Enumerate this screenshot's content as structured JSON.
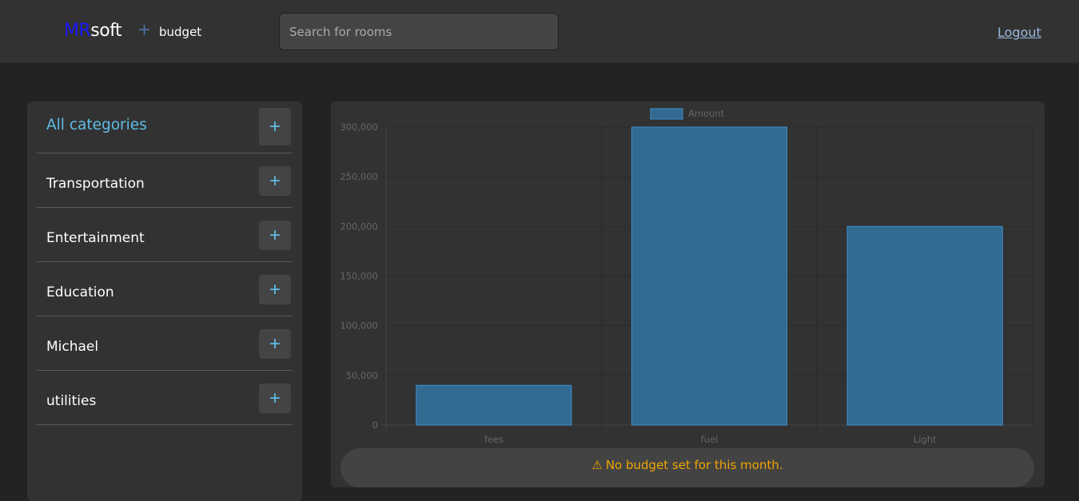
{
  "header": {
    "logo_part1": "MR",
    "logo_part2": "soft",
    "plus_symbol": "+",
    "app_name": "budget",
    "search_placeholder": "Search for rooms",
    "logout_label": "Logout"
  },
  "sidebar": {
    "items": [
      {
        "label": "All categories",
        "active": true
      },
      {
        "label": "Transportation"
      },
      {
        "label": "Entertainment"
      },
      {
        "label": "Education"
      },
      {
        "label": "Michael"
      },
      {
        "label": "utilities"
      }
    ],
    "add_symbol": "+"
  },
  "chart_data": {
    "type": "bar",
    "categories": [
      "fees",
      "fuel",
      "Light"
    ],
    "series": [
      {
        "name": "Amount",
        "values": [
          40000,
          300000,
          200000
        ]
      }
    ],
    "ylim": [
      0,
      300000
    ],
    "yticks": [
      "0",
      "50,000",
      "100,000",
      "150,000",
      "200,000",
      "250,000",
      "300,000"
    ],
    "legend_position": "top",
    "grid": true,
    "colors": {
      "bar_fill": "#326a91",
      "bar_stroke": "#3f8fcc"
    }
  },
  "notice": {
    "icon": "warning-icon",
    "text": "No budget set for this month."
  }
}
